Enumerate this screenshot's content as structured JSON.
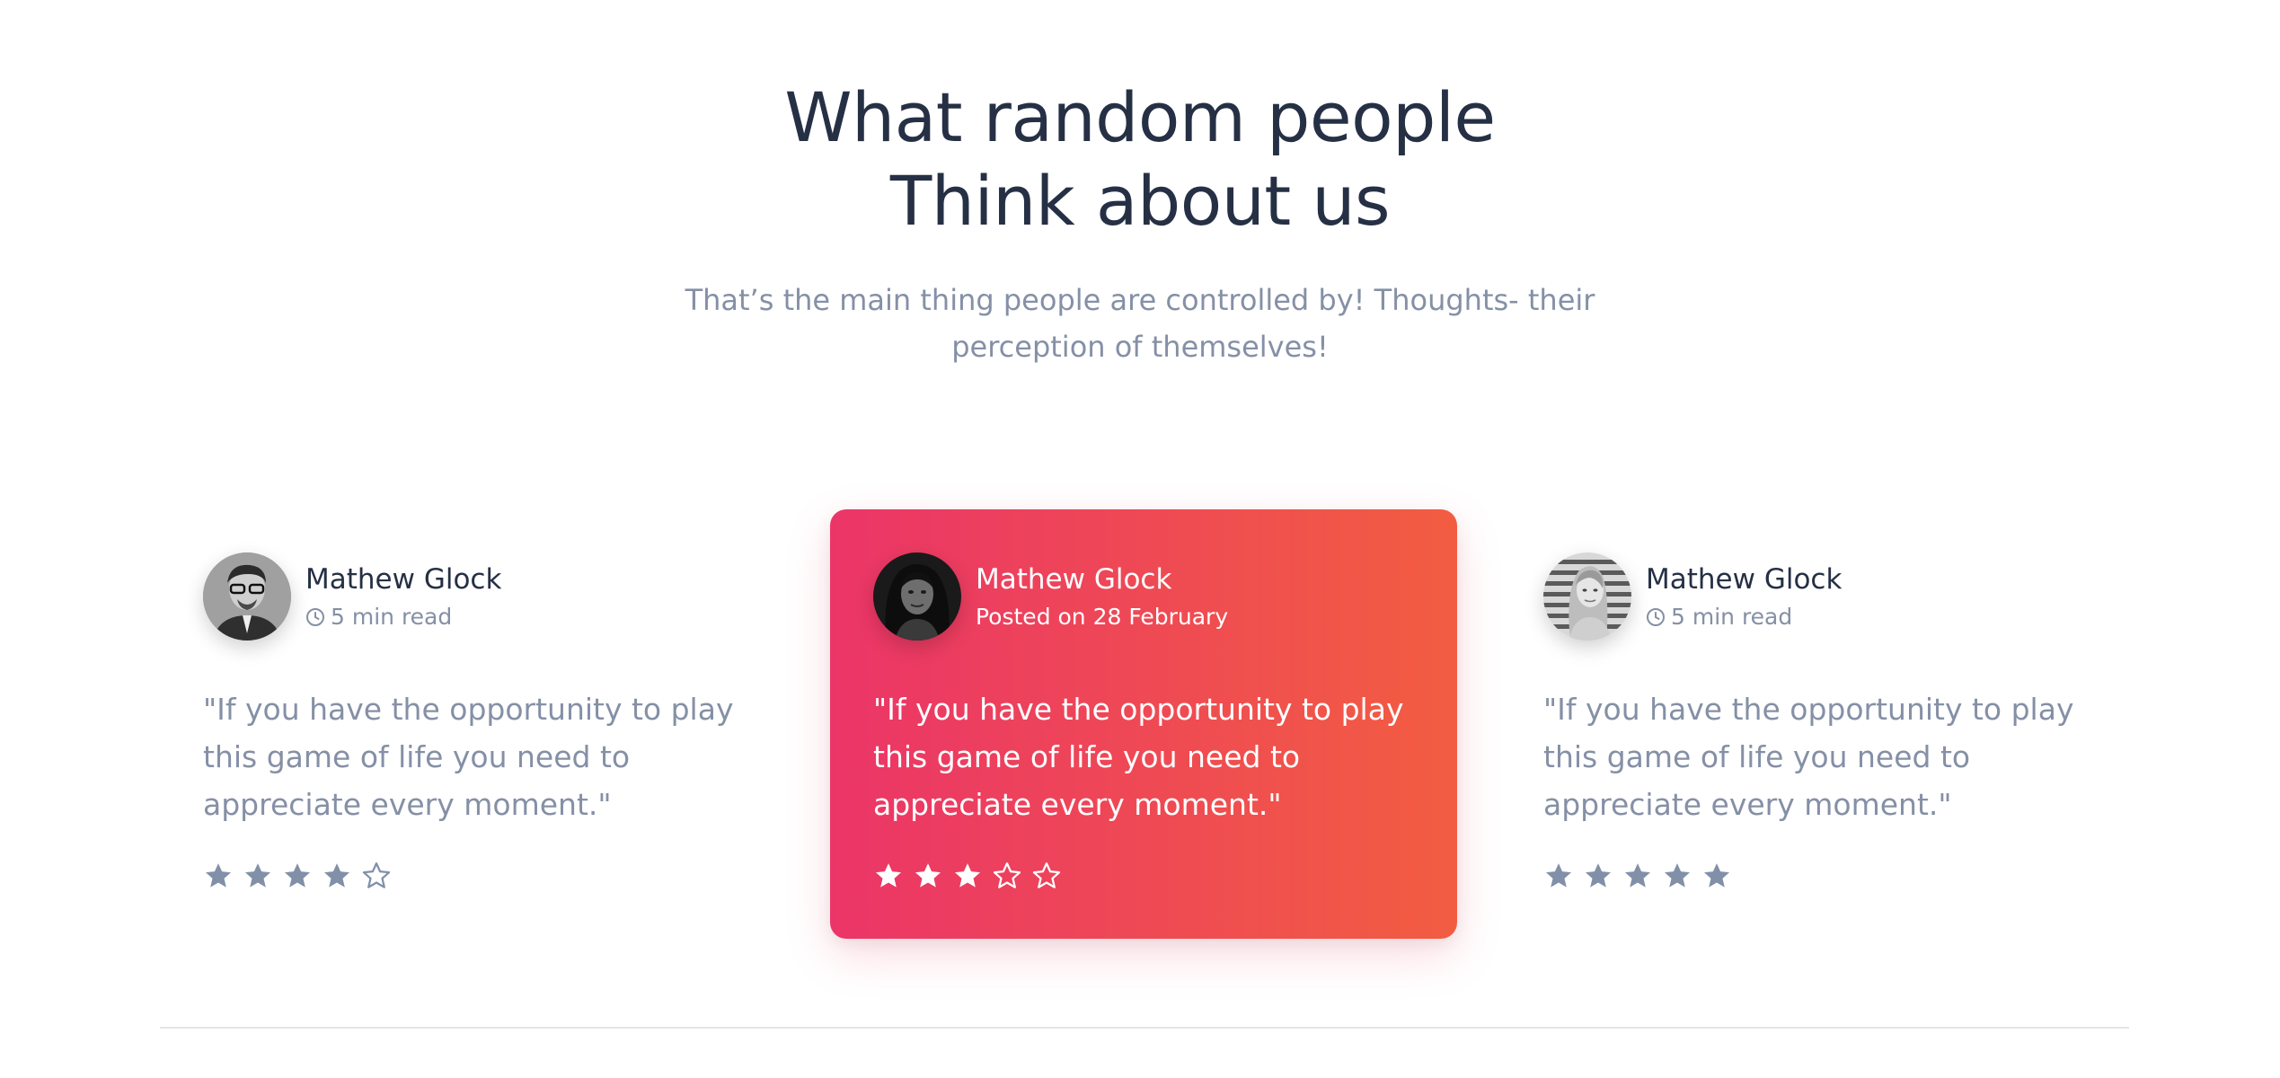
{
  "header": {
    "title_line1": "What random people",
    "title_line2": "Think about us",
    "subtitle": "That’s the main thing people are controlled by! Thoughts- their perception of themselves!"
  },
  "testimonials": [
    {
      "name": "Mathew Glock",
      "meta": "5 min read",
      "meta_icon": "clock-icon",
      "quote": "\"If you have the opportunity to play this game of life you need to appreciate every moment.\"",
      "rating": 4,
      "rating_max": 5,
      "highlighted": false
    },
    {
      "name": "Mathew Glock",
      "meta": "Posted on 28 February",
      "meta_icon": "",
      "quote": "\"If you have the opportunity to play this game of life you need to appreciate every moment.\"",
      "rating": 3,
      "rating_max": 5,
      "highlighted": true
    },
    {
      "name": "Mathew Glock",
      "meta": "5 min read",
      "meta_icon": "clock-icon",
      "quote": "\"If you have the opportunity to play this game of life you need to appreciate every moment.\"",
      "rating": 5,
      "rating_max": 5,
      "highlighted": false
    }
  ],
  "colors": {
    "title": "#263045",
    "muted": "#8590a6",
    "star_muted": "#8190a8",
    "gradient_start": "#eb3568",
    "gradient_end": "#f25d41",
    "divider": "#e3e5ea"
  }
}
